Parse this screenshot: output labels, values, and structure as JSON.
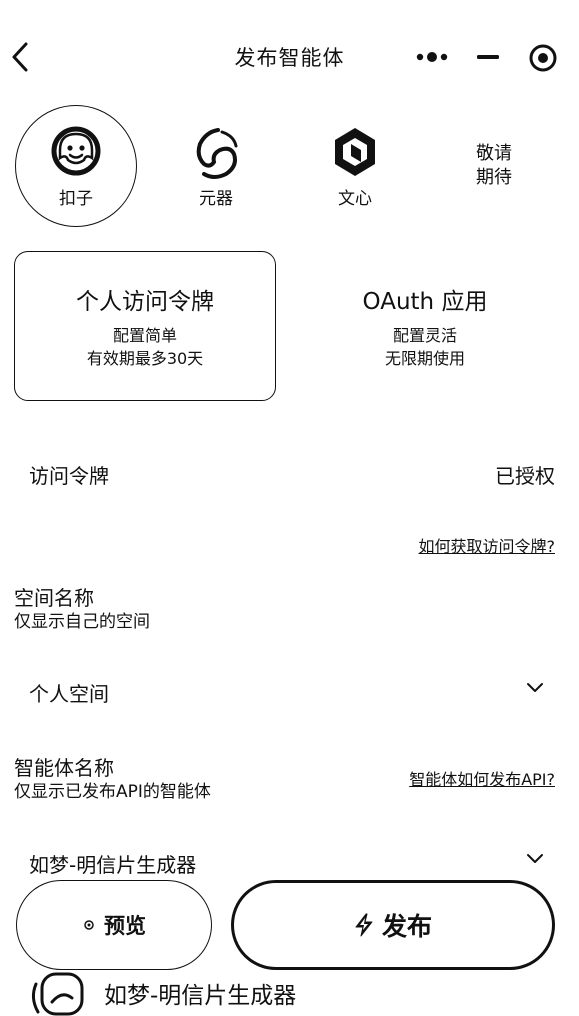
{
  "header": {
    "title": "发布智能体",
    "icons": [
      "back-icon",
      "more-icon",
      "minus-icon",
      "target-icon"
    ]
  },
  "platforms": {
    "coze": "扣子",
    "yuanqi": "元器",
    "wenxin": "文心",
    "coming_soon_line1": "敬请",
    "coming_soon_line2": "期待"
  },
  "auth": {
    "pat": {
      "title": "个人访问令牌",
      "desc1": "配置简单",
      "desc2": "有效期最多30天"
    },
    "oauth": {
      "title": "OAuth 应用",
      "desc1": "配置灵活",
      "desc2": "无限期使用"
    }
  },
  "token": {
    "label": "访问令牌",
    "status": "已授权",
    "help_link": "如何获取访问令牌?"
  },
  "space": {
    "title": "空间名称",
    "subtitle": "仅显示自己的空间",
    "value": "个人空间"
  },
  "agent": {
    "title": "智能体名称",
    "subtitle": "仅显示已发布API的智能体",
    "help_link": "智能体如何发布API?",
    "value": "如梦-明信片生成器"
  },
  "buttons": {
    "preview": "预览",
    "publish": "发布"
  },
  "bottom_item": {
    "name": "如梦-明信片生成器"
  }
}
